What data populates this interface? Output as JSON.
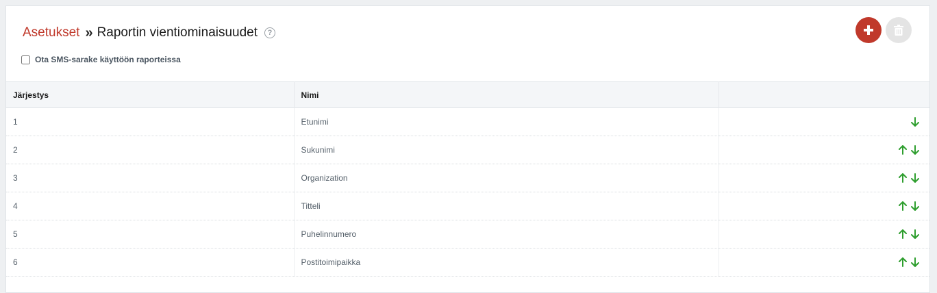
{
  "breadcrumb": {
    "parent": "Asetukset",
    "separator": "»",
    "current": "Raportin vientiominaisuudet",
    "help_glyph": "?"
  },
  "sms_option": {
    "label": "Ota SMS-sarake käyttöön raporteissa",
    "checked": false
  },
  "actions": {
    "add_icon": "plus-icon",
    "delete_icon": "trash-icon"
  },
  "table": {
    "headers": [
      "Järjestys",
      "Nimi",
      ""
    ],
    "rows": [
      {
        "order": "1",
        "name": "Etunimi",
        "up": false,
        "down": true
      },
      {
        "order": "2",
        "name": "Sukunimi",
        "up": true,
        "down": true
      },
      {
        "order": "3",
        "name": "Organization",
        "up": true,
        "down": true
      },
      {
        "order": "4",
        "name": "Titteli",
        "up": true,
        "down": true
      },
      {
        "order": "5",
        "name": "Puhelinnumero",
        "up": true,
        "down": true
      },
      {
        "order": "6",
        "name": "Postitoimipaikka",
        "up": true,
        "down": true
      }
    ]
  },
  "colors": {
    "accent": "#c0392b",
    "arrow": "#2e9e2e"
  }
}
